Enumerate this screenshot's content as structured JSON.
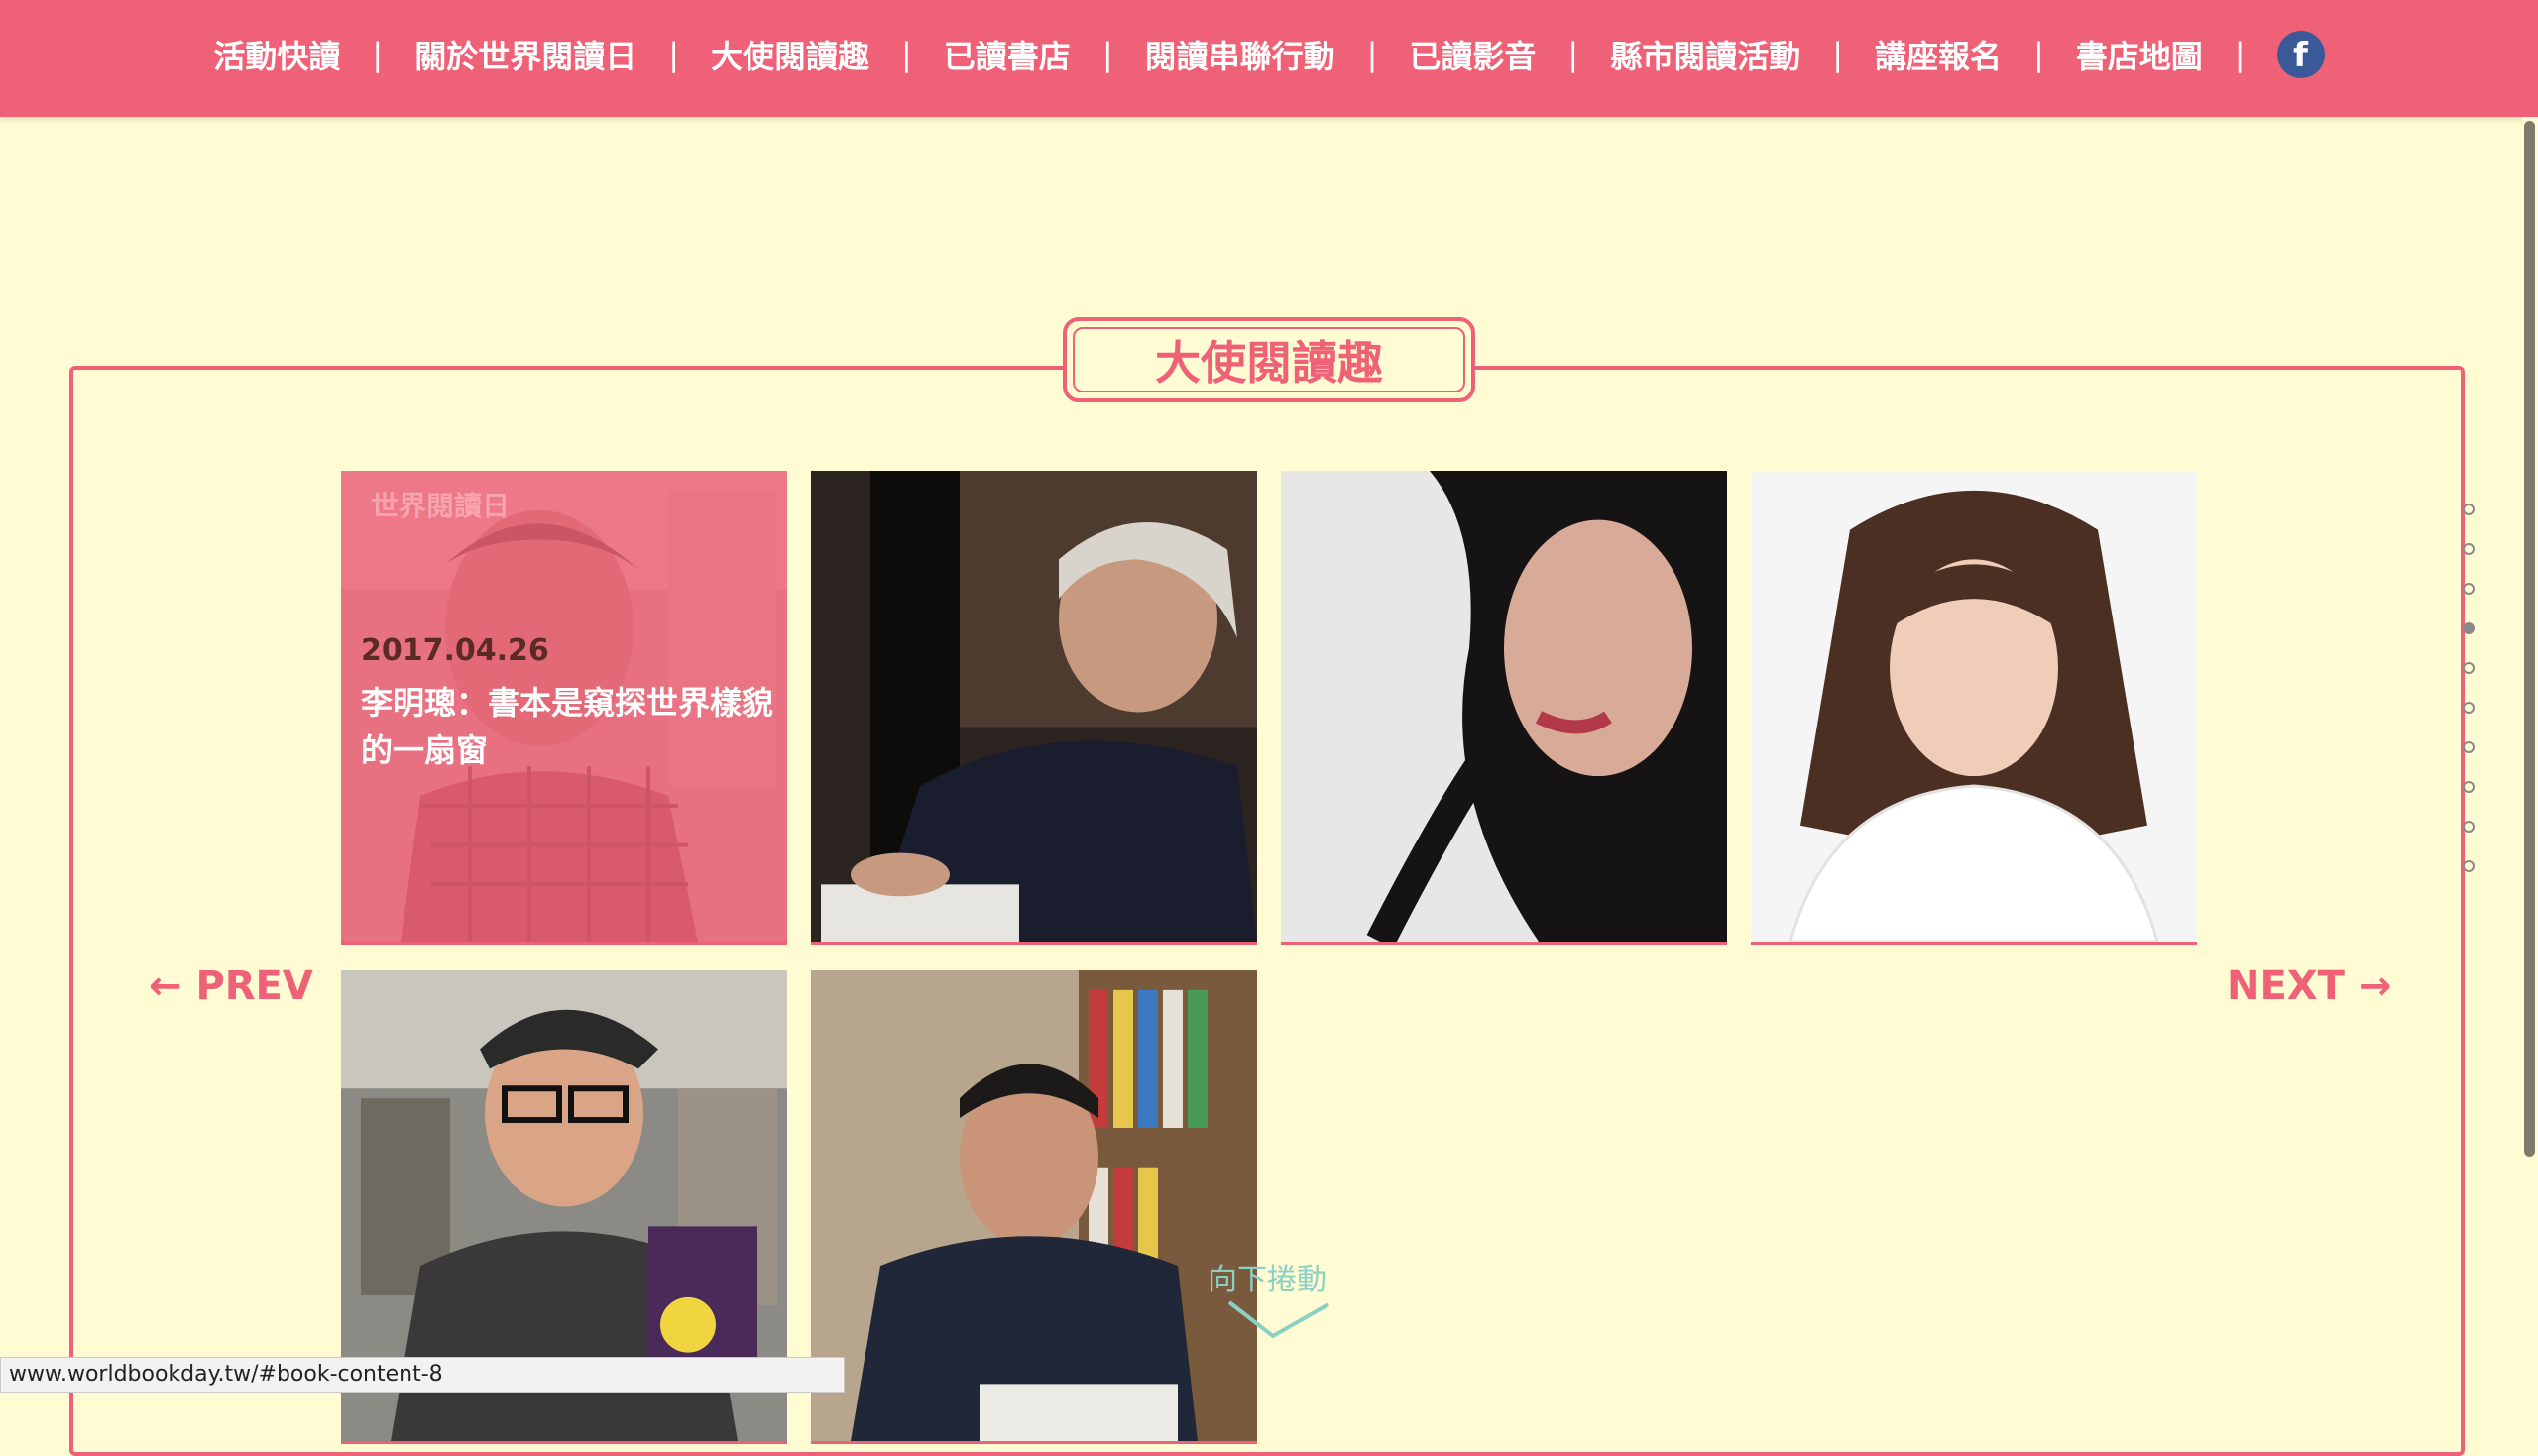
{
  "nav": {
    "items": [
      "活動快讀",
      "關於世界閱讀日",
      "大使閱讀趣",
      "已讀書店",
      "閱讀串聯行動",
      "已讀影音",
      "縣市閱讀活動",
      "講座報名",
      "書店地圖"
    ],
    "separator": "|",
    "facebook_icon": "facebook-icon"
  },
  "section": {
    "title": "大使閱讀趣"
  },
  "cards": [
    {
      "date": "2017.04.26",
      "title": "李明璁：書本是窺探世界樣貌的一扇窗",
      "logo": "世界閱讀日"
    }
  ],
  "pagination": {
    "prev": "← PREV",
    "next": "NEXT →"
  },
  "side_nav": {
    "count": 10,
    "active_index": 3
  },
  "scroll_hint": "向下捲動",
  "status_url": "www.worldbookday.tw/#book-content-8",
  "colors": {
    "brand": "#ee6176",
    "background": "#fffbd2",
    "hint": "#8ad0c4"
  }
}
